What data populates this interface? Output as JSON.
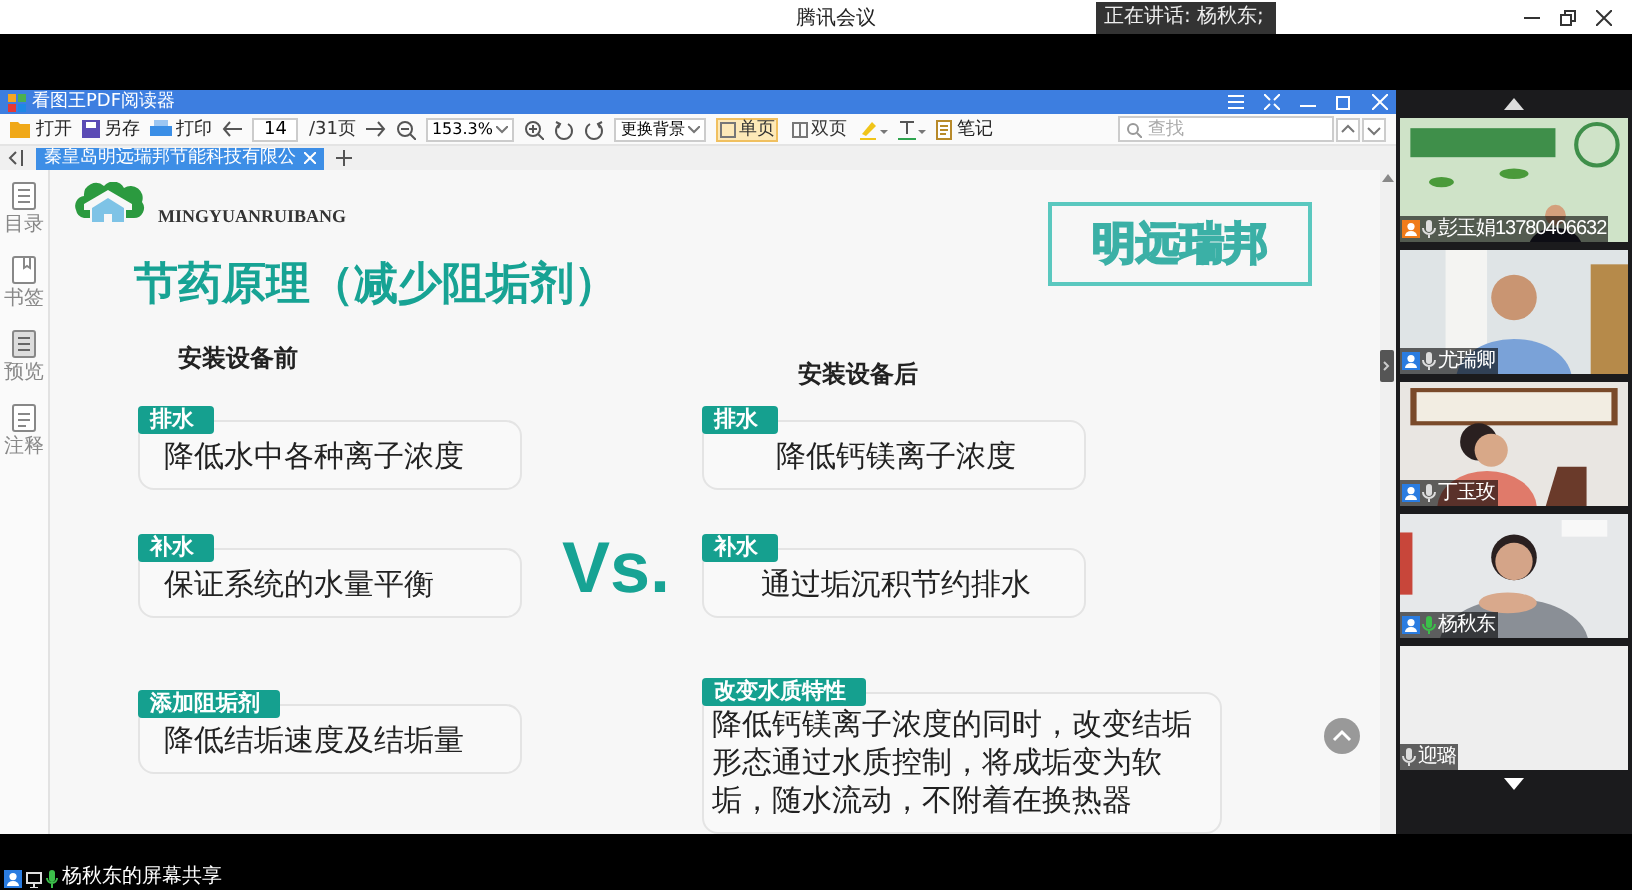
{
  "meeting": {
    "title": "腾讯会议",
    "speaking": "正在讲话: 杨秋东;"
  },
  "reader": {
    "title": "看图王PDF阅读器",
    "toolbar": {
      "open": "打开",
      "save_as": "另存",
      "print": "打印",
      "page": "14",
      "page_total": "/31页",
      "zoom": "153.3%",
      "background": "更换背景",
      "note": "笔记",
      "search_placeholder": "查找",
      "views": [
        {
          "label": "单页",
          "selected": true
        },
        {
          "label": "双页",
          "selected": false
        }
      ]
    },
    "tabs": [
      {
        "label": "秦皇岛明远瑞邦节能科技有限公",
        "selected": true
      }
    ],
    "sidebar": [
      {
        "label": "目录",
        "kind": "list"
      },
      {
        "label": "书签",
        "kind": "bookmark"
      },
      {
        "label": "预览",
        "kind": "preview"
      },
      {
        "label": "注释",
        "kind": "note"
      }
    ]
  },
  "slide": {
    "brand_en": "MINGYUANRUIBANG",
    "brand_box": "明远瑞邦",
    "title": "节药原理（减少阻垢剂）",
    "vs": "Vs.",
    "columns": [
      {
        "heading": "安装设备前",
        "cards": [
          {
            "tag": "排水",
            "text": "降低水中各种离子浓度"
          },
          {
            "tag": "补水",
            "text": "保证系统的水量平衡"
          },
          {
            "tag": "添加阻垢剂",
            "text": "降低结垢速度及结垢量"
          }
        ]
      },
      {
        "heading": "安装设备后",
        "cards": [
          {
            "tag": "排水",
            "text": "降低钙镁离子浓度"
          },
          {
            "tag": "补水",
            "text": "通过垢沉积节约排水"
          },
          {
            "tag": "改变水质特性",
            "text": "降低钙镁离子浓度的同时，改变结垢形态通过水质控制，将成垢变为软垢，随水流动，不附着在换热器"
          }
        ]
      }
    ]
  },
  "participants": [
    {
      "name": "彭玉娟13780406632",
      "kind": "video",
      "host": true,
      "speaking": false
    },
    {
      "name": "尤瑞卿",
      "kind": "video",
      "host": false,
      "speaking": false
    },
    {
      "name": "丁玉玫",
      "kind": "video",
      "host": false,
      "speaking": false
    },
    {
      "name": "杨秋东",
      "kind": "video",
      "host": false,
      "speaking": true
    },
    {
      "name": "迎璐",
      "kind": "off",
      "speaking": false
    }
  ],
  "share_status": "杨秋东的屏幕共享"
}
